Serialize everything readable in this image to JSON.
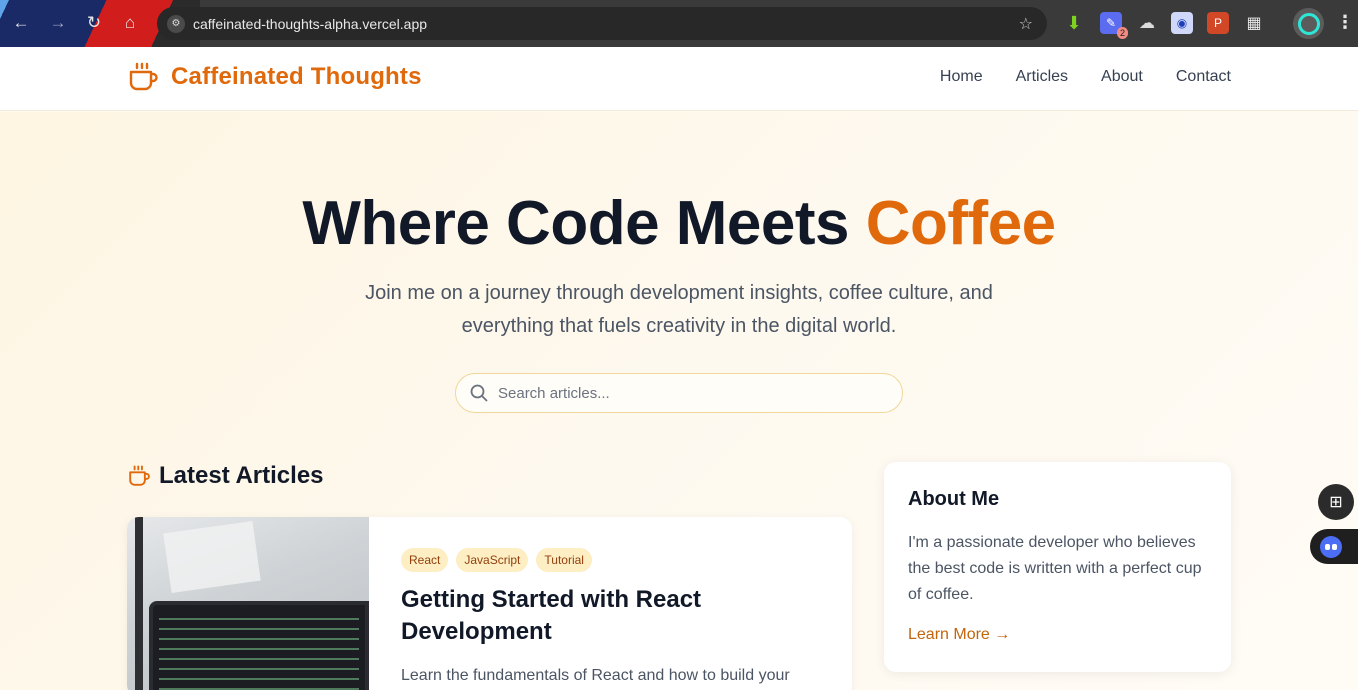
{
  "browser": {
    "url": "caffeinated-thoughts-alpha.vercel.app",
    "extension_badge": "2"
  },
  "site": {
    "brand": "Caffeinated Thoughts",
    "nav": [
      "Home",
      "Articles",
      "About",
      "Contact"
    ]
  },
  "hero": {
    "title_main": "Where Code Meets ",
    "title_accent": "Coffee",
    "subtitle": "Join me on a journey through development insights, coffee culture, and everything that fuels creativity in the digital world.",
    "search_placeholder": "Search articles..."
  },
  "latest": {
    "heading": "Latest Articles",
    "article": {
      "tags": [
        "React",
        "JavaScript",
        "Tutorial"
      ],
      "title": "Getting Started with React Development",
      "excerpt": "Learn the fundamentals of React and how to build your"
    }
  },
  "about": {
    "heading": "About Me",
    "text": "I'm a passionate developer who believes the best code is written with a perfect cup of coffee.",
    "link": "Learn More →"
  },
  "colors": {
    "accent": "#e0690b",
    "tag_bg": "#fdeec3",
    "tag_text": "#92400e"
  }
}
